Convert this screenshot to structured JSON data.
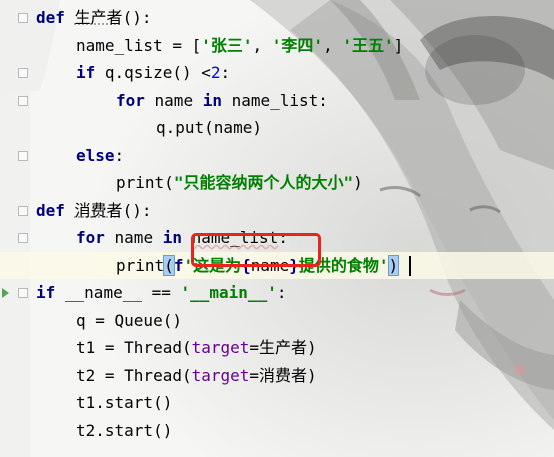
{
  "editor": {
    "lines": [
      {
        "tokens": [
          {
            "t": "def",
            "c": "tok-kw"
          },
          {
            "t": " ",
            "c": "tok-plain"
          },
          {
            "t": "生产者",
            "c": "tok-def fn-name underline-dotted"
          },
          {
            "t": "():",
            "c": "tok-plain"
          }
        ],
        "indent": 0
      },
      {
        "tokens": [
          {
            "t": "name_list = [",
            "c": "tok-plain"
          },
          {
            "t": "'张三'",
            "c": "tok-str"
          },
          {
            "t": ", ",
            "c": "tok-plain"
          },
          {
            "t": "'李四'",
            "c": "tok-str"
          },
          {
            "t": ", ",
            "c": "tok-plain"
          },
          {
            "t": "'王五'",
            "c": "tok-str"
          },
          {
            "t": "]",
            "c": "tok-plain"
          }
        ],
        "indent": 1
      },
      {
        "tokens": [
          {
            "t": "if",
            "c": "tok-kw"
          },
          {
            "t": " q.qsize() <",
            "c": "tok-plain"
          },
          {
            "t": "2",
            "c": "tok-num"
          },
          {
            "t": ":",
            "c": "tok-plain"
          }
        ],
        "indent": 1
      },
      {
        "tokens": [
          {
            "t": "for",
            "c": "tok-kw"
          },
          {
            "t": " name ",
            "c": "tok-plain"
          },
          {
            "t": "in",
            "c": "tok-kw"
          },
          {
            "t": " name_list:",
            "c": "tok-plain"
          }
        ],
        "indent": 2
      },
      {
        "tokens": [
          {
            "t": "q.put(name)",
            "c": "tok-plain"
          }
        ],
        "indent": 3
      },
      {
        "tokens": [
          {
            "t": "else",
            "c": "tok-kw"
          },
          {
            "t": ":",
            "c": "tok-plain"
          }
        ],
        "indent": 1
      },
      {
        "tokens": [
          {
            "t": "print",
            "c": "tok-callname"
          },
          {
            "t": "(",
            "c": "tok-plain"
          },
          {
            "t": "\"只能容纳两个人的大小\"",
            "c": "tok-str"
          },
          {
            "t": ")",
            "c": "tok-plain"
          }
        ],
        "indent": 2
      },
      {
        "tokens": [
          {
            "t": "def",
            "c": "tok-kw"
          },
          {
            "t": " ",
            "c": "tok-plain"
          },
          {
            "t": "消费者",
            "c": "tok-def fn-name underline-dotted"
          },
          {
            "t": "():",
            "c": "tok-plain"
          }
        ],
        "indent": 0
      },
      {
        "tokens": [
          {
            "t": "for",
            "c": "tok-kw"
          },
          {
            "t": " name ",
            "c": "tok-plain"
          },
          {
            "t": "in",
            "c": "tok-kw"
          },
          {
            "t": " ",
            "c": "tok-plain"
          },
          {
            "t": "name_list",
            "c": "tok-plain warn-squiggle"
          },
          {
            "t": ":",
            "c": "tok-plain"
          }
        ],
        "indent": 1
      },
      {
        "tokens": [
          {
            "t": "print",
            "c": "tok-callname"
          },
          {
            "t": "(",
            "c": "tok-plain bracket-match"
          },
          {
            "t": "f",
            "c": "tok-fmtkw"
          },
          {
            "t": "'这是为",
            "c": "tok-str"
          },
          {
            "t": "{",
            "c": "tok-fmtkw"
          },
          {
            "t": "name",
            "c": "tok-plain"
          },
          {
            "t": "}",
            "c": "tok-fmtkw"
          },
          {
            "t": "提供的食物'",
            "c": "tok-str"
          },
          {
            "t": ")",
            "c": "tok-plain bracket-match"
          }
        ],
        "indent": 2,
        "highlighted": true
      },
      {
        "tokens": [
          {
            "t": "if",
            "c": "tok-kw"
          },
          {
            "t": " ",
            "c": "tok-plain"
          },
          {
            "t": "__name__",
            "c": "tok-plain"
          },
          {
            "t": " == ",
            "c": "tok-plain"
          },
          {
            "t": "'__main__'",
            "c": "tok-str"
          },
          {
            "t": ":",
            "c": "tok-plain"
          }
        ],
        "indent": 0,
        "run": true
      },
      {
        "tokens": [
          {
            "t": "q = Queue()",
            "c": "tok-plain"
          }
        ],
        "indent": 1
      },
      {
        "tokens": [
          {
            "t": "t1 = Thread(",
            "c": "tok-plain"
          },
          {
            "t": "target",
            "c": "tok-kwarg"
          },
          {
            "t": "=生产者)",
            "c": "tok-plain"
          }
        ],
        "indent": 1
      },
      {
        "tokens": [
          {
            "t": "t2 = Thread(",
            "c": "tok-plain"
          },
          {
            "t": "target",
            "c": "tok-kwarg"
          },
          {
            "t": "=消费者)",
            "c": "tok-plain"
          }
        ],
        "indent": 1
      },
      {
        "tokens": [
          {
            "t": "t1.start()",
            "c": "tok-plain"
          }
        ],
        "indent": 1
      },
      {
        "tokens": [
          {
            "t": "t2.start()",
            "c": "tok-plain"
          }
        ],
        "indent": 1
      }
    ]
  },
  "colors": {
    "keyword": "#000080",
    "string": "#008000",
    "number": "#0000ff",
    "kwarg": "#660099",
    "annotation_box": "#e8241d",
    "current_line": "#fcfae8",
    "run_marker": "#4fa84f"
  }
}
